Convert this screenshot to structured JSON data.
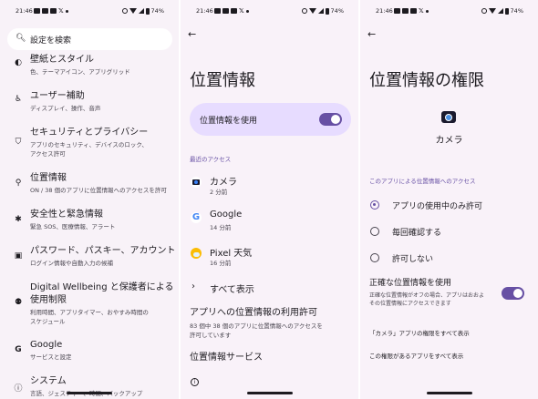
{
  "status_bar": {
    "time": "21:46",
    "notif_x": "𝕏",
    "battery": "74%"
  },
  "screen1": {
    "search_placeholder": "設定を検索",
    "items": [
      {
        "icon": "palette-icon",
        "glyph": "◐",
        "title": "壁紙とスタイル",
        "subtitle": "色、テーマアイコン、アプリグリッド"
      },
      {
        "icon": "accessibility-icon",
        "glyph": "♿",
        "title": "ユーザー補助",
        "subtitle": "ディスプレイ、操作、音声"
      },
      {
        "icon": "security-icon",
        "glyph": "⛉",
        "title": "セキュリティとプライバシー",
        "subtitle": "アプリのセキュリティ、デバイスのロック、\nアクセス許可"
      },
      {
        "icon": "location-icon",
        "glyph": "⚲",
        "title": "位置情報",
        "subtitle": "ON / 38 個のアプリに位置情報へのアクセスを許可"
      },
      {
        "icon": "emergency-icon",
        "glyph": "✱",
        "title": "安全性と緊急情報",
        "subtitle": "緊急 SOS、医療情報、アラート"
      },
      {
        "icon": "password-icon",
        "glyph": "▣",
        "title": "パスワード、パスキー、アカウント",
        "subtitle": "ログイン情報や自動入力の候補"
      },
      {
        "icon": "wellbeing-icon",
        "glyph": "⚉",
        "title": "Digital Wellbeing と保護者による\n使用制限",
        "subtitle": "利用時間、アプリタイマー、おやすみ時間の\nスケジュール"
      },
      {
        "icon": "google-icon",
        "glyph": "G",
        "title": "Google",
        "subtitle": "サービスと設定"
      },
      {
        "icon": "system-icon",
        "glyph": "ⓘ",
        "title": "システム",
        "subtitle": "言語、ジェスチャー、時間、バックアップ"
      }
    ]
  },
  "screen2": {
    "title": "位置情報",
    "use_location_label": "位置情報を使用",
    "use_location_on": true,
    "recent_access_header": "最近のアクセス",
    "recent_apps": [
      {
        "icon": "camera-app-icon",
        "name": "カメラ",
        "time": "2 分前"
      },
      {
        "icon": "google-app-icon",
        "name": "Google",
        "time": "14 分前"
      },
      {
        "icon": "weather-app-icon",
        "name": "Pixel 天気",
        "time": "16 分前"
      }
    ],
    "show_all": "すべて表示",
    "app_permission_title": "アプリへの位置情報の利用許可",
    "app_permission_sub": "83 個中 38 個のアプリに位置情報へのアクセスを\n許可しています",
    "location_services": "位置情報サービス"
  },
  "screen3": {
    "title": "位置情報の権限",
    "app_name": "カメラ",
    "section_header": "このアプリによる位置情報へのアクセス",
    "options": [
      {
        "label": "アプリの使用中のみ許可",
        "selected": true
      },
      {
        "label": "毎回確認する",
        "selected": false
      },
      {
        "label": "許可しない",
        "selected": false
      }
    ],
    "precise_title": "正確な位置情報を使用",
    "precise_sub": "正確な位置情報がオフの場合、アプリはおおよ\nその位置情報にアクセスできます",
    "precise_on": true,
    "link_all_camera_perms": "「カメラ」アプリの権限をすべて表示",
    "link_all_apps_with_perm": "この権限があるアプリをすべて表示"
  },
  "colors": {
    "accent": "#6750a4",
    "card": "#e7dcff",
    "background": "#f8f2f8"
  }
}
